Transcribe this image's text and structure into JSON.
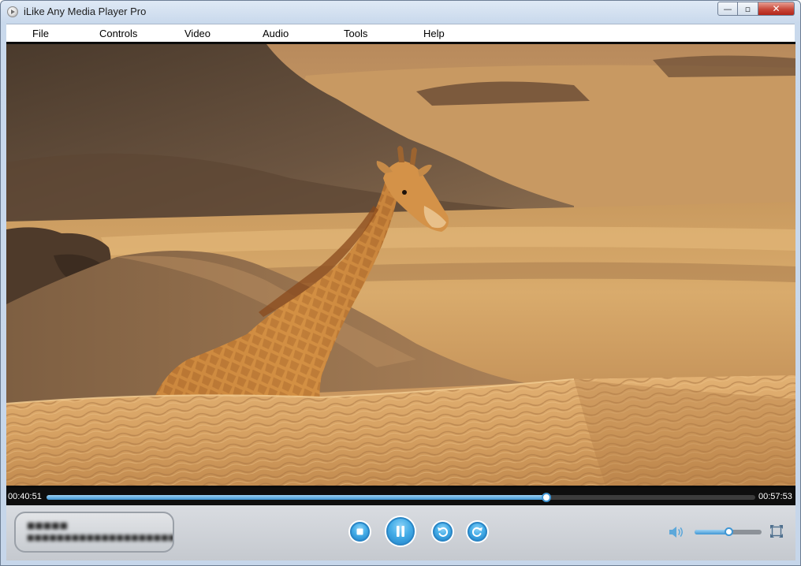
{
  "window": {
    "title": "iLike Any Media Player Pro",
    "controls": {
      "minimize": "—",
      "maximize": "▫",
      "close": "✕"
    }
  },
  "menu": [
    {
      "label": "File"
    },
    {
      "label": "Controls"
    },
    {
      "label": "Video"
    },
    {
      "label": "Audio"
    },
    {
      "label": "Tools"
    },
    {
      "label": "Help"
    }
  ],
  "video": {
    "scene": "giraffe-in-desert-dunes"
  },
  "playback": {
    "current_time": "00:40:51",
    "total_time": "00:57:53",
    "progress": 0.705,
    "state": "playing"
  },
  "info_panel": {
    "line1": "■■■■■",
    "line2": "■■■■■■■■■■■■■■■■■■■■■■"
  },
  "volume": {
    "level": 0.5
  },
  "icons": {
    "stop": "stop-icon",
    "pause": "pause-icon",
    "rewind": "rewind-icon",
    "forward": "forward-icon",
    "volume": "speaker-icon",
    "fullscreen": "fullscreen-icon"
  },
  "colors": {
    "accent": "#3f96d4",
    "button_light": "#8fd3f7",
    "close_red": "#c8483a"
  }
}
